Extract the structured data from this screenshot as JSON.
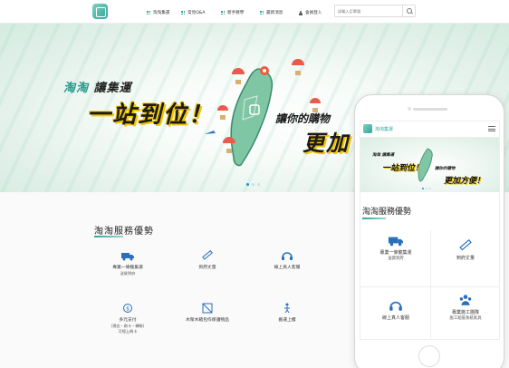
{
  "nav": {
    "items": [
      {
        "label": "淘淘集運",
        "icon": "grid-icon"
      },
      {
        "label": "常見Q&A",
        "icon": "grid-icon"
      },
      {
        "label": "新手教學",
        "icon": "grid-icon"
      },
      {
        "label": "最新消息",
        "icon": "grid-icon"
      },
      {
        "label": "會員登入",
        "icon": "user-icon"
      }
    ],
    "search_placeholder": "試輸入訂單號"
  },
  "hero": {
    "line1_a": "淘淘",
    "line1_b": "讓集運",
    "line2": "一站到位！",
    "line3": "讓你的購物",
    "line4": "更加"
  },
  "services": {
    "title": "淘淘服務優勢",
    "items": [
      {
        "title": "專業一條龍集運",
        "sub": "送貨到府",
        "icon": "truck-icon"
      },
      {
        "title": "到府丈量",
        "sub": "",
        "icon": "ruler-icon"
      },
      {
        "title": "線上真人客服",
        "sub": "",
        "icon": "headset-icon"
      },
      {
        "title": "多元支付",
        "sub": "(現金・刷卡・轉帳)",
        "sub2": "可線上刷卡",
        "icon": "payment-icon"
      },
      {
        "title": "木架木箱包作保護物品",
        "sub": "",
        "icon": "crate-icon"
      },
      {
        "title": "搬運上樓",
        "sub": "",
        "icon": "stairs-icon"
      }
    ]
  },
  "mobile": {
    "brand": "淘淘集運",
    "hero": {
      "line1": "淘淘 讓集運",
      "line2": "一站到位！",
      "line3": "讓你的購物",
      "line4": "更加方便！"
    },
    "section_title": "淘淘服務優勢",
    "items": [
      {
        "title": "專業一條龍集運",
        "sub": "送貨到府",
        "icon": "truck-icon"
      },
      {
        "title": "到府丈量",
        "sub": "",
        "icon": "ruler-icon"
      },
      {
        "title": "線上真人客服",
        "sub": "",
        "icon": "headset-icon"
      },
      {
        "title": "專業施工團隊",
        "sub": "施工組裝系統家具",
        "icon": "team-icon"
      }
    ]
  },
  "colors": {
    "accent": "#2fa89a",
    "highlight": "#f2c500",
    "dot_active": "#2a8ec8"
  }
}
